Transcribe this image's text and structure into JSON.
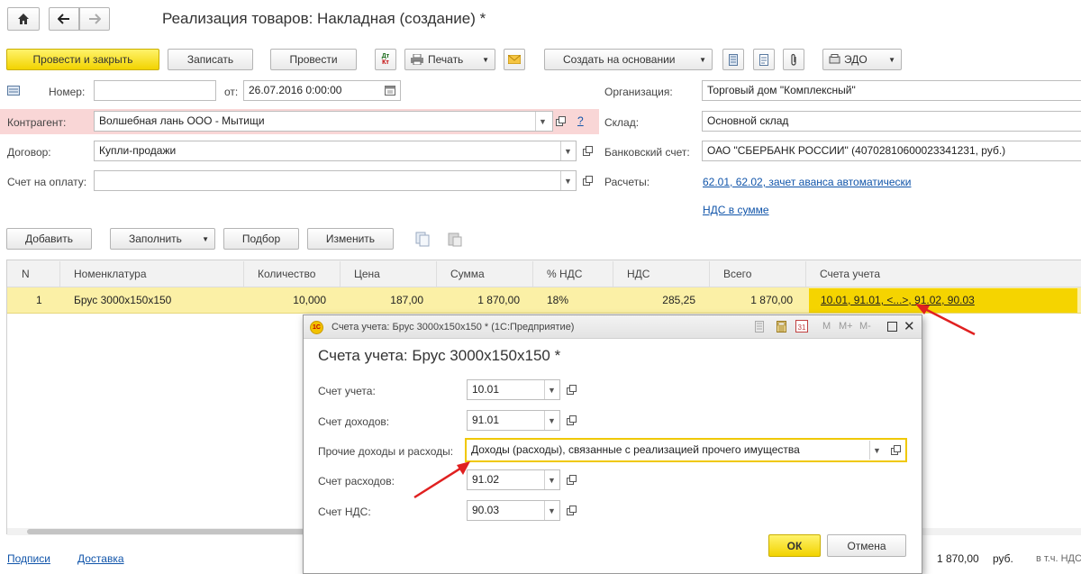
{
  "header": {
    "title": "Реализация товаров: Накладная (создание) *"
  },
  "toolbar": {
    "post_close": "Провести и закрыть",
    "save": "Записать",
    "post": "Провести",
    "dt_kt_top": "Дт",
    "dt_kt_bottom": "Кт",
    "print": "Печать",
    "create_based": "Создать на основании",
    "edo": "ЭДО"
  },
  "form": {
    "number_label": "Номер:",
    "number_value": "",
    "date_label": "от:",
    "date_value": "26.07.2016  0:00:00",
    "counterparty_label": "Контрагент:",
    "counterparty_value": "Волшебная лань ООО - Мытищи",
    "help_mark": "?",
    "contract_label": "Договор:",
    "contract_value": "Купли-продажи",
    "invoice_label": "Счет на оплату:",
    "invoice_value": "",
    "org_label": "Организация:",
    "org_value": "Торговый дом \"Комплексный\"",
    "warehouse_label": "Склад:",
    "warehouse_value": "Основной склад",
    "bank_label": "Банковский счет:",
    "bank_value": "ОАО \"СБЕРБАНК РОССИИ\" (40702810600023341231, руб.)",
    "settlements_label": "Расчеты:",
    "settlements_link": "62.01, 62.02, зачет аванса автоматически",
    "vat_link": "НДС в сумме"
  },
  "table_toolbar": {
    "add": "Добавить",
    "fill": "Заполнить",
    "pick": "Подбор",
    "change": "Изменить"
  },
  "table": {
    "columns": [
      "N",
      "Номенклатура",
      "Количество",
      "Цена",
      "Сумма",
      "% НДС",
      "НДС",
      "Всего",
      "Счета учета"
    ],
    "rows": [
      {
        "n": "1",
        "item": "Брус 3000x150x150",
        "qty": "10,000",
        "price": "187,00",
        "sum": "1 870,00",
        "vat_rate": "18%",
        "vat": "285,25",
        "total": "1 870,00",
        "accounts": "10.01, 91.01, <...>, 91.02, 90.03"
      }
    ]
  },
  "footer": {
    "signatures": "Подписи",
    "delivery": "Доставка",
    "total": "1 870,00",
    "currency": "руб.",
    "incl": "в т.ч. НДС"
  },
  "dialog": {
    "titlebar": "Счета учета: Брус 3000x150x150 * (1С:Предприятие)",
    "heading": "Счета учета: Брус 3000x150x150 *",
    "acc_label": "Счет учета:",
    "acc_value": "10.01",
    "income_label": "Счет доходов:",
    "income_value": "91.01",
    "other_label": "Прочие доходы и расходы:",
    "other_value": "Доходы (расходы), связанные с реализацией прочего имущества",
    "expense_label": "Счет расходов:",
    "expense_value": "91.02",
    "vat_label": "Счет НДС:",
    "vat_value": "90.03",
    "ok": "ОК",
    "cancel": "Отмена",
    "m": "M",
    "m_plus": "M+",
    "m_minus": "M-",
    "calendar_day": "31"
  },
  "colors": {
    "accent_yellow": "#f2d300",
    "selected_row": "#fbf0a6",
    "highlight_field": "#f9d6d6",
    "link": "#1155aa",
    "arrow_red": "#e02020"
  }
}
